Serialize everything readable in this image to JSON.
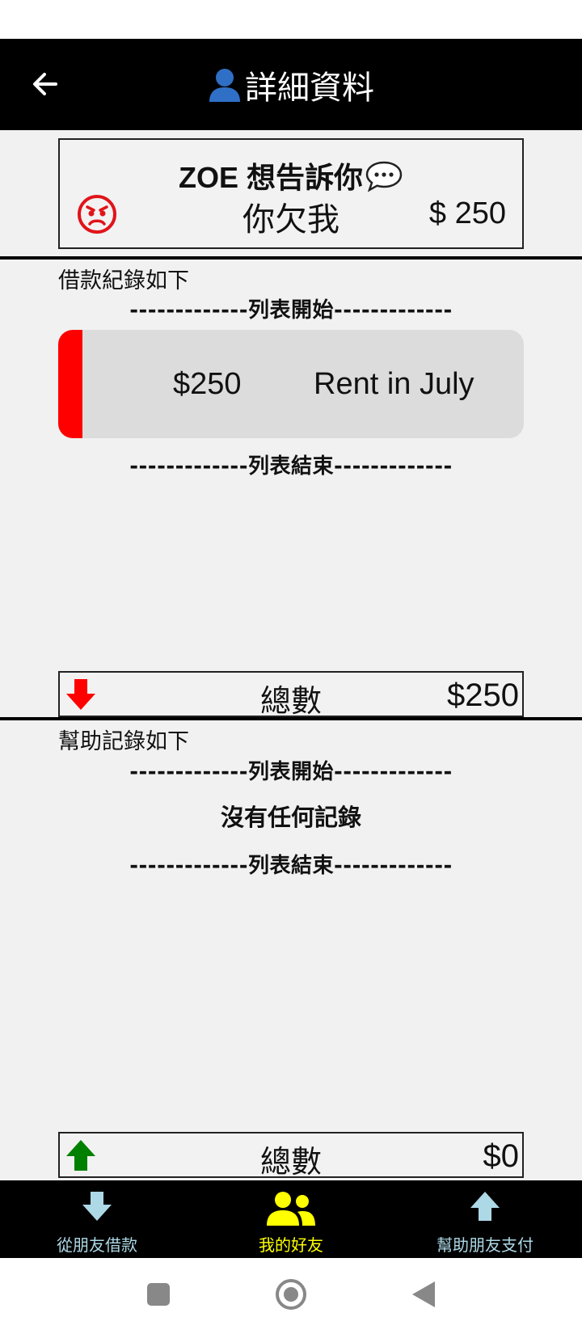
{
  "header": {
    "title": "詳細資料"
  },
  "message_card": {
    "title": "ZOE 想告訴你",
    "owe_text": "你欠我",
    "amount": "$ 250"
  },
  "borrow_section": {
    "label": "借款紀錄如下",
    "list_start": "-------------列表開始-------------",
    "records": [
      {
        "amount": "$250",
        "description": "Rent in July",
        "status_color": "#ff0000"
      }
    ],
    "list_end": "-------------列表結束-------------",
    "total_label": "總數",
    "total_value": "$250"
  },
  "help_section": {
    "label": "幫助記錄如下",
    "list_start": "-------------列表開始-------------",
    "empty_text": "沒有任何記錄",
    "list_end": "-------------列表結束-------------",
    "total_label": "總數",
    "total_value": "$0"
  },
  "bottom_nav": {
    "items": [
      {
        "label": "從朋友借款",
        "icon": "arrow-down-icon",
        "active": false
      },
      {
        "label": "我的好友",
        "icon": "friends-icon",
        "active": true
      },
      {
        "label": "幫助朋友支付",
        "icon": "arrow-up-icon",
        "active": false
      }
    ],
    "active_color": "#ffff00",
    "inactive_color": "#add8e6"
  },
  "colors": {
    "app_bar": "#000000",
    "debt_red": "#ff0000",
    "help_green": "#008000"
  }
}
